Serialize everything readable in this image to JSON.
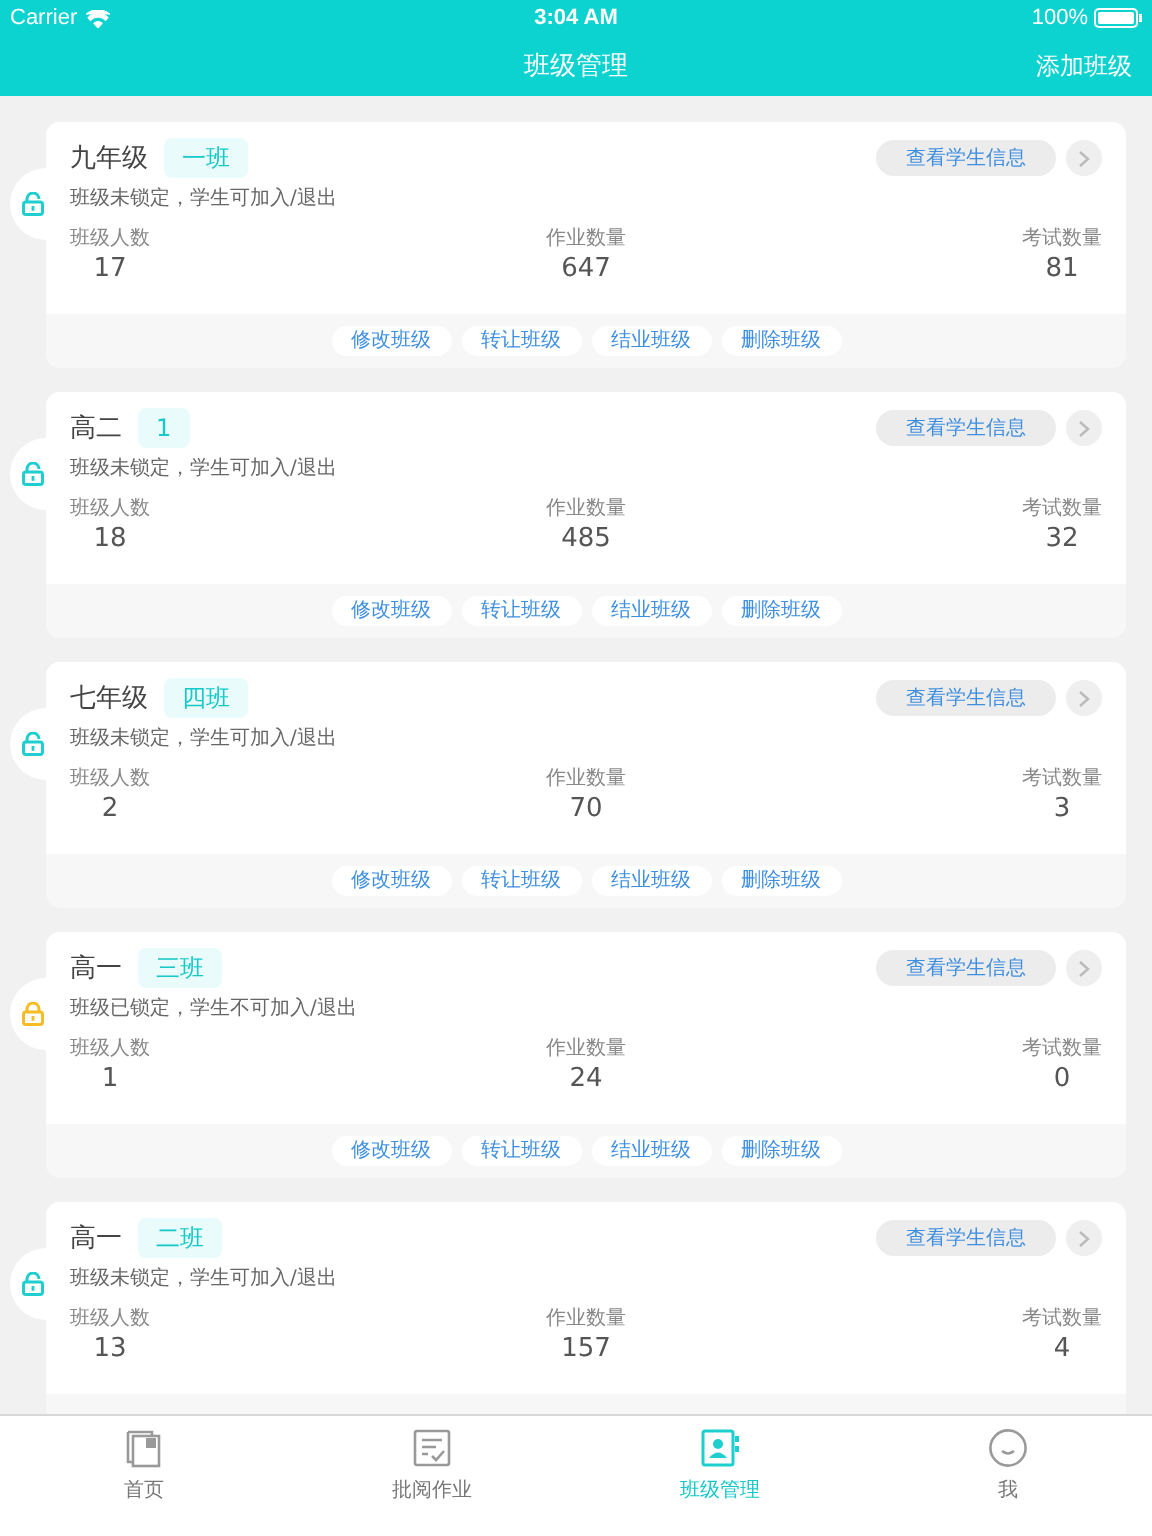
{
  "status_bar": {
    "carrier": "Carrier",
    "time": "3:04 AM",
    "battery": "100%"
  },
  "nav": {
    "title": "班级管理",
    "action": "添加班级"
  },
  "classes": [
    {
      "grade": "九年级",
      "class_name": "一班",
      "locked": false,
      "status": "班级未锁定，学生可加入/退出",
      "stats": [
        {
          "label": "班级人数",
          "value": "17"
        },
        {
          "label": "作业数量",
          "value": "647"
        },
        {
          "label": "考试数量",
          "value": "81"
        }
      ],
      "info_button": "查看学生信息",
      "actions": [
        "修改班级",
        "转让班级",
        "结业班级",
        "删除班级"
      ]
    },
    {
      "grade": "高二",
      "class_name": "1",
      "locked": false,
      "status": "班级未锁定，学生可加入/退出",
      "stats": [
        {
          "label": "班级人数",
          "value": "18"
        },
        {
          "label": "作业数量",
          "value": "485"
        },
        {
          "label": "考试数量",
          "value": "32"
        }
      ],
      "info_button": "查看学生信息",
      "actions": [
        "修改班级",
        "转让班级",
        "结业班级",
        "删除班级"
      ]
    },
    {
      "grade": "七年级",
      "class_name": "四班",
      "locked": false,
      "status": "班级未锁定，学生可加入/退出",
      "stats": [
        {
          "label": "班级人数",
          "value": "2"
        },
        {
          "label": "作业数量",
          "value": "70"
        },
        {
          "label": "考试数量",
          "value": "3"
        }
      ],
      "info_button": "查看学生信息",
      "actions": [
        "修改班级",
        "转让班级",
        "结业班级",
        "删除班级"
      ]
    },
    {
      "grade": "高一",
      "class_name": "三班",
      "locked": true,
      "status": "班级已锁定，学生不可加入/退出",
      "stats": [
        {
          "label": "班级人数",
          "value": "1"
        },
        {
          "label": "作业数量",
          "value": "24"
        },
        {
          "label": "考试数量",
          "value": "0"
        }
      ],
      "info_button": "查看学生信息",
      "actions": [
        "修改班级",
        "转让班级",
        "结业班级",
        "删除班级"
      ]
    },
    {
      "grade": "高一",
      "class_name": "二班",
      "locked": false,
      "status": "班级未锁定，学生可加入/退出",
      "stats": [
        {
          "label": "班级人数",
          "value": "13"
        },
        {
          "label": "作业数量",
          "value": "157"
        },
        {
          "label": "考试数量",
          "value": "4"
        }
      ],
      "info_button": "查看学生信息"
    }
  ],
  "tab_bar": [
    {
      "label": "首页",
      "kind": "home",
      "selected": false
    },
    {
      "label": "批阅作业",
      "kind": "review",
      "selected": false
    },
    {
      "label": "班级管理",
      "kind": "classes",
      "selected": true
    },
    {
      "label": "我",
      "kind": "me",
      "selected": false
    }
  ]
}
